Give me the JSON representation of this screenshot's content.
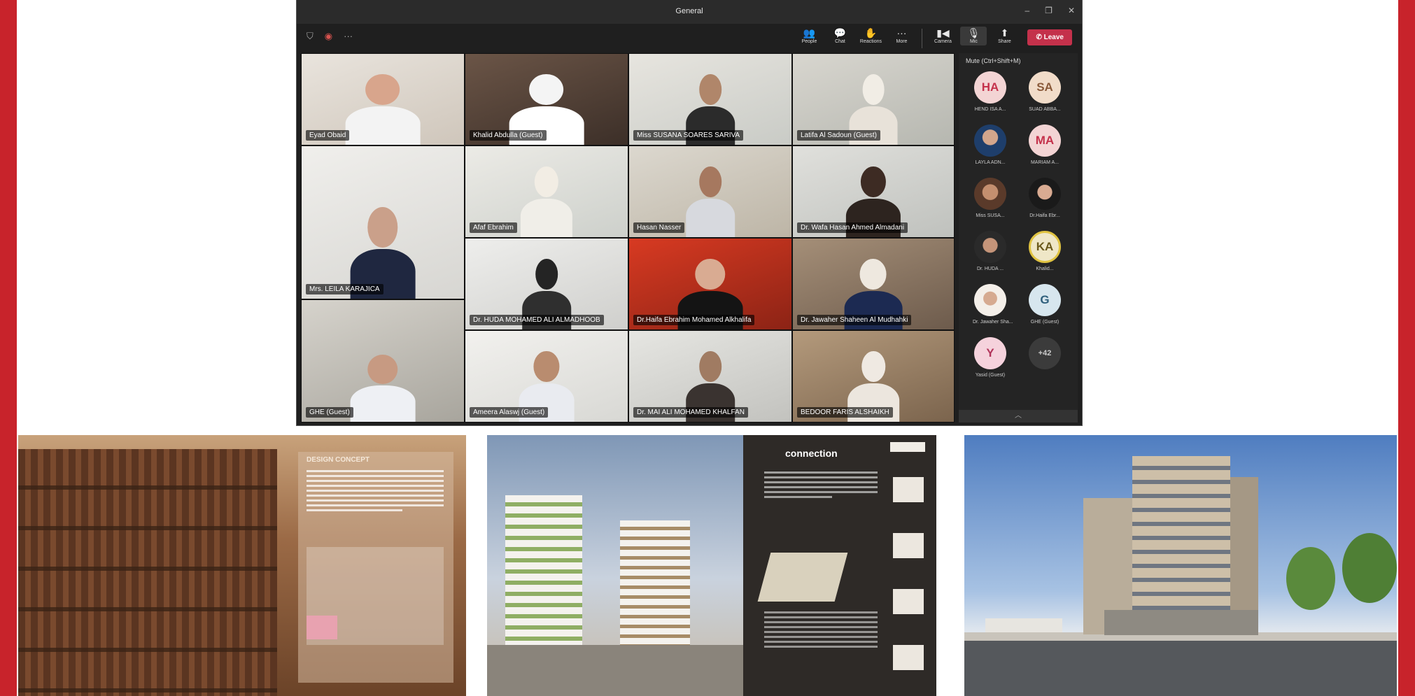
{
  "window": {
    "title": "General",
    "controls": [
      "–",
      "❐",
      "✕"
    ]
  },
  "toolbar": {
    "left_icons": [
      "shield-icon",
      "record-icon",
      "more-icon"
    ],
    "items": [
      {
        "label": "People",
        "icon": "people-icon"
      },
      {
        "label": "Chat",
        "icon": "chat-icon"
      },
      {
        "label": "Reactions",
        "icon": "reactions-icon"
      },
      {
        "label": "More",
        "icon": "more-icon"
      },
      {
        "label": "Camera",
        "icon": "camera-icon"
      },
      {
        "label": "Mic",
        "icon": "mic-icon"
      },
      {
        "label": "Share",
        "icon": "share-icon"
      }
    ],
    "leave_label": "Leave"
  },
  "tiles": [
    {
      "name": "Eyad Obaid"
    },
    {
      "name": "Khalid Abdulla (Guest)"
    },
    {
      "name": "Miss SUSANA SOARES SARIVA"
    },
    {
      "name": "Latifa Al Sadoun (Guest)"
    },
    {
      "name": "Afaf Ebrahim"
    },
    {
      "name": "Hasan Nasser"
    },
    {
      "name": "Dr. Wafa Hasan Ahmed Almadani"
    },
    {
      "name": "Mrs. LEILA KARAJICA"
    },
    {
      "name": "Dr. HUDA MOHAMED ALI ALMADHOOB"
    },
    {
      "name": "Dr.Haifa Ebrahim Mohamed Alkhalifa"
    },
    {
      "name": "Dr. Jawaher Shaheen Al Mudhahki"
    },
    {
      "name": "GHE (Guest)"
    },
    {
      "name": "Ameera Alaswj (Guest)"
    },
    {
      "name": "Dr. MAI ALI MOHAMED KHALFAN"
    },
    {
      "name": "BEDOOR FARIS ALSHAIKH"
    }
  ],
  "panel": {
    "header": "Mute (Ctrl+Shift+M)",
    "participants": [
      {
        "initials": "HA",
        "label": "HEND ISA A..."
      },
      {
        "initials": "SA",
        "label": "SUAD ABBA..."
      },
      {
        "initials": "",
        "label": "LAYLA ADN..."
      },
      {
        "initials": "MA",
        "label": "MARIAM A..."
      },
      {
        "initials": "",
        "label": "Miss SUSA..."
      },
      {
        "initials": "",
        "label": "Dr.Haifa Ebr..."
      },
      {
        "initials": "",
        "label": "Dr. HUDA ..."
      },
      {
        "initials": "KA",
        "label": "Khalid..."
      },
      {
        "initials": "",
        "label": "Dr. Jawaher Sha..."
      },
      {
        "initials": "G",
        "label": "GHE (Guest)"
      },
      {
        "initials": "Y",
        "label": "Yasid (Guest)"
      },
      {
        "initials": "+42",
        "label": ""
      }
    ]
  },
  "posters": {
    "design_concept_title": "DESIGN CONCEPT",
    "connection_title": "connection"
  },
  "colors": {
    "accent_red": "#c8232b",
    "leave_red": "#c4314b",
    "teams_dark": "#1f1f1f"
  }
}
